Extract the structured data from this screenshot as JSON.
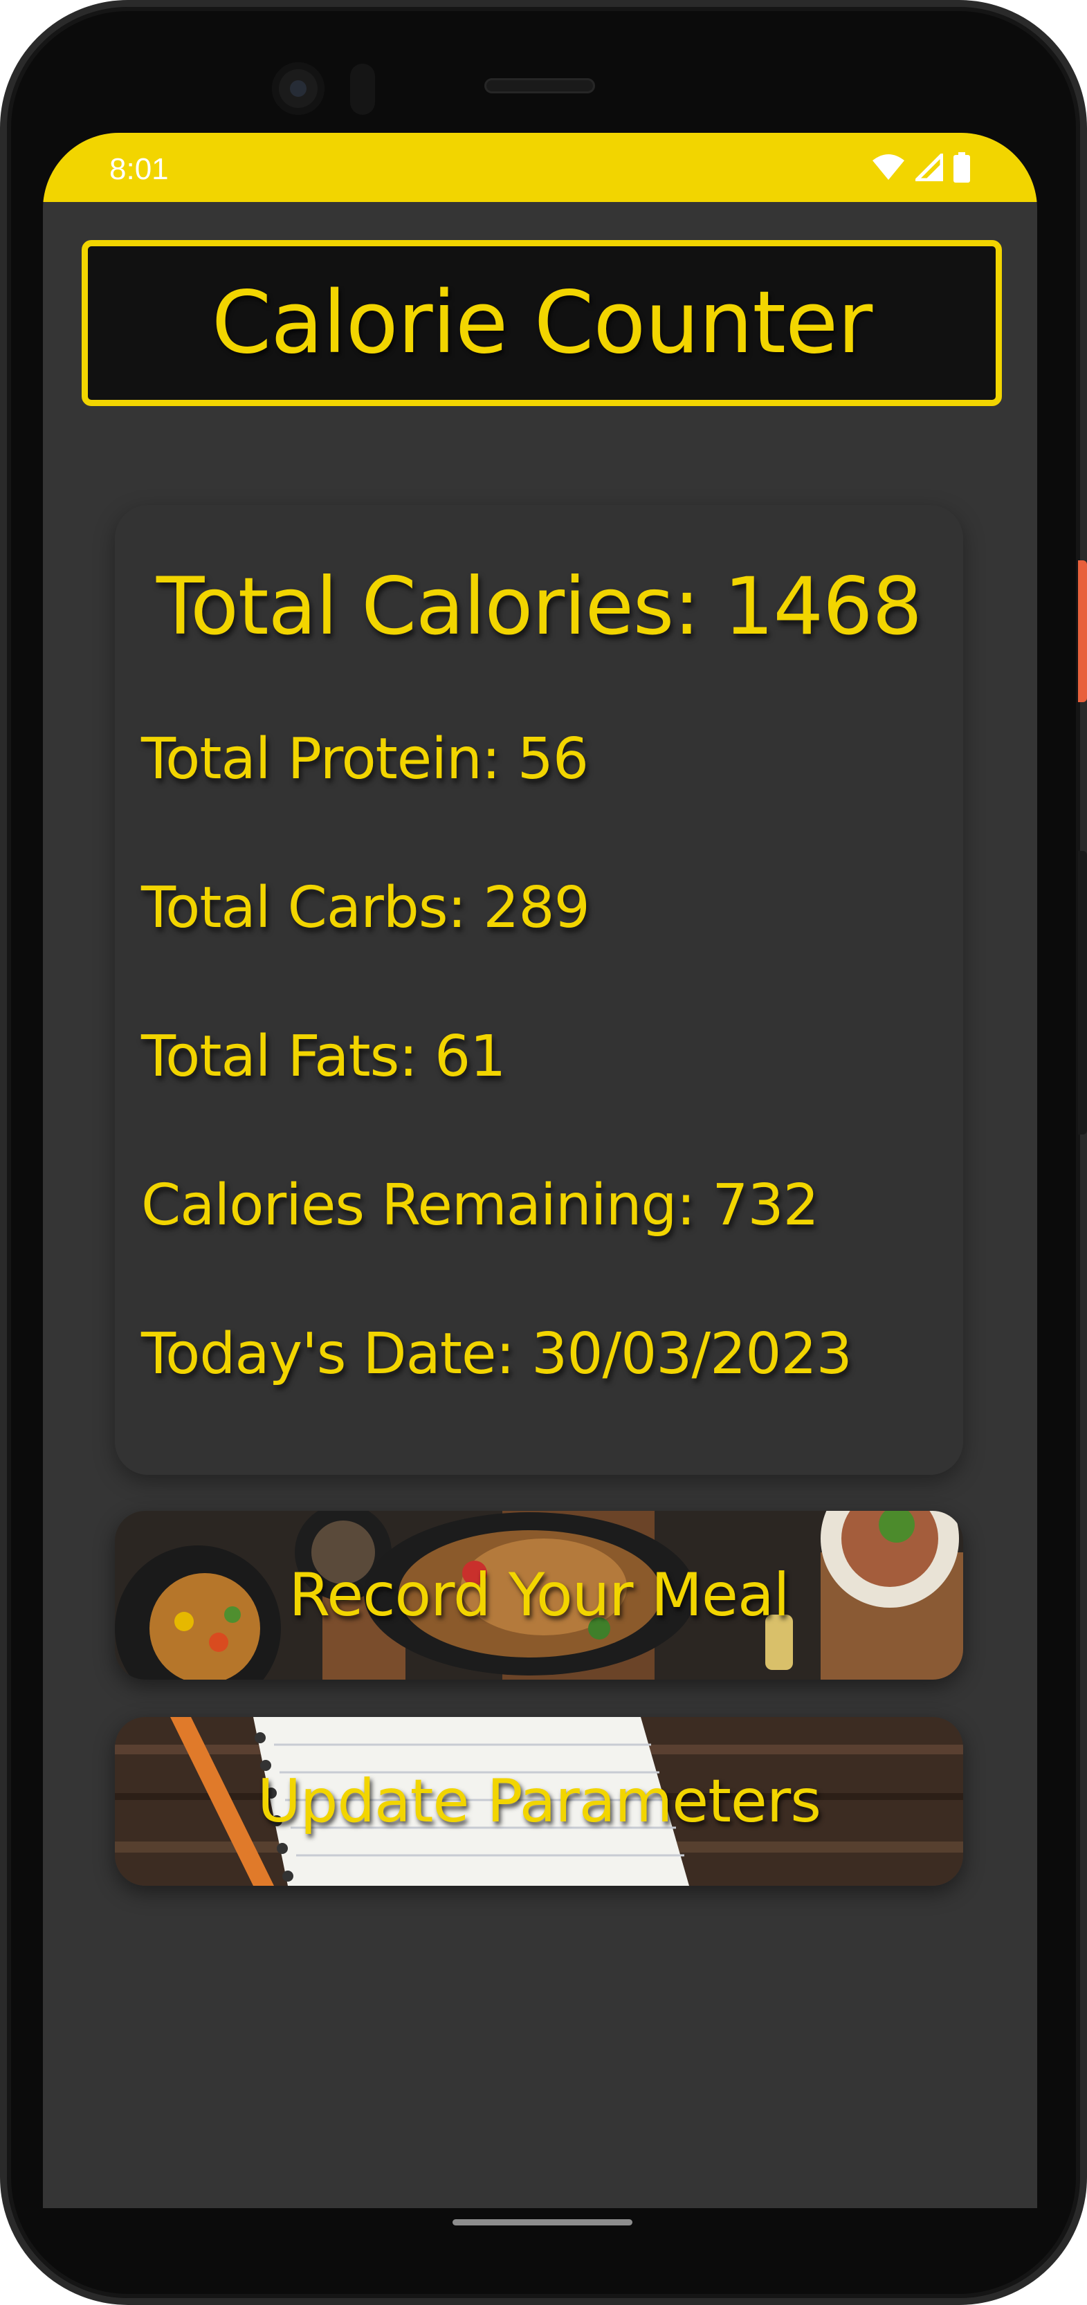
{
  "status_bar": {
    "time": "8:01",
    "icons": [
      "wifi-icon",
      "cell-signal-icon",
      "battery-icon"
    ],
    "color": "#f2d500"
  },
  "app": {
    "title": "Calorie Counter",
    "accent_color": "#f2d500",
    "background_color": "#353535"
  },
  "stats": {
    "total_calories": "Total Calories: 1468",
    "total_protein": "Total Protein: 56",
    "total_carbs": "Total Carbs: 289",
    "total_fats": "Total Fats: 61",
    "calories_remaining": "Calories Remaining: 732",
    "todays_date": "Today's Date: 30/03/2023"
  },
  "actions": {
    "record_meal": "Record Your Meal",
    "update_parameters": "Update Parameters"
  }
}
